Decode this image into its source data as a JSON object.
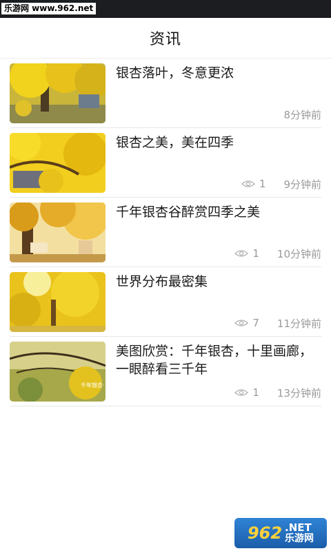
{
  "status_bar": {
    "watermark": "乐游网 www.962.net"
  },
  "header": {
    "title": "资讯"
  },
  "articles": [
    {
      "title": "银杏落叶，冬意更浓",
      "views": "",
      "time": "8分钟前"
    },
    {
      "title": "银杏之美，美在四季",
      "views": "1",
      "time": "9分钟前"
    },
    {
      "title": "千年银杏谷醉赏四季之美",
      "views": "1",
      "time": "10分钟前"
    },
    {
      "title": "世界分布最密集",
      "views": "7",
      "time": "11分钟前"
    },
    {
      "title": "美图欣赏：千年银杏，十里画廊，一眼醉看三千年",
      "views": "1",
      "time": "13分钟前",
      "thumb_caption": "千年银杏·"
    }
  ],
  "footer_watermark": {
    "number": "962",
    "suffix": ".NET",
    "name": "乐游网"
  },
  "colors": {
    "status_bar": "#1b1d20",
    "meta_text": "#9a9a9a",
    "ginkgo_yellow": "#e8c21a"
  }
}
